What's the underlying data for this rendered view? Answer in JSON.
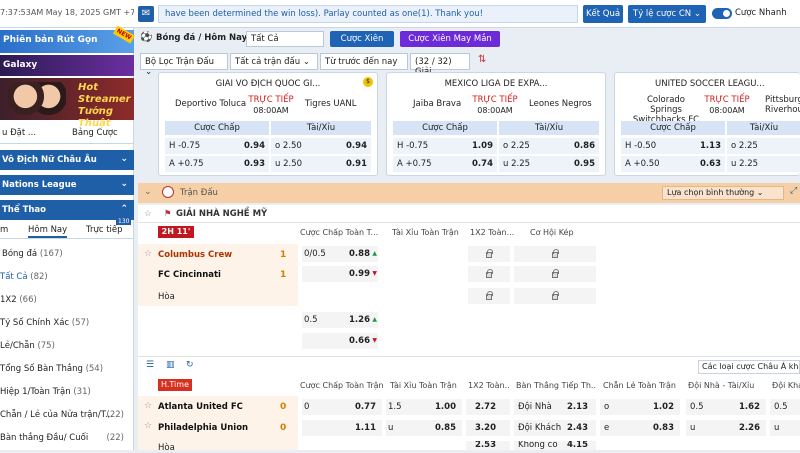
{
  "topbar": {
    "time": "7:37:53AM May 18, 2025 GMT +7",
    "marquee": "have been determined the win loss). Parlay counted as one(1). Thank you!",
    "ket_qua": "Kết Quả",
    "ty_le": "Tỷ lệ cược CN ⌄",
    "toggle_label": "Cược Nhanh"
  },
  "sidebar": {
    "promo1": "Phiên bản Rút Gọn",
    "promo1_badge": "NEW",
    "promo2": "Galaxy",
    "promo3a": "Hot Streamer",
    "promo3b": "Tướng Thuật",
    "tab_left": "u Đặt ...",
    "tab_right": "Bảng Cược",
    "sec1": "Vô Địch Nữ Châu Âu",
    "sec2": "Nations League",
    "sec3": "Thể Thao",
    "subtabs": [
      "m",
      "Hôm Nay",
      "Trực tiếp"
    ],
    "live_badge": "130",
    "items": [
      {
        "label": "Bóng đá",
        "count": "(167)"
      },
      {
        "label": "Tất Cả",
        "count": "(82)"
      },
      {
        "label": "1X2",
        "count": "(66)"
      },
      {
        "label": "Tỷ Số Chính Xác",
        "count": "(57)"
      },
      {
        "label": "Lẻ/Chẵn",
        "count": "(75)"
      },
      {
        "label": "Tổng Số Bàn Thắng",
        "count": "(54)"
      },
      {
        "label": "Hiệp 1/Toàn Trận",
        "count": "(31)"
      },
      {
        "label": "Chẵn / Lẻ của Nửa trận/T...",
        "count": "(22)"
      },
      {
        "label": "Bàn thắng Đầu/ Cuối",
        "count": "(22)"
      }
    ]
  },
  "header": {
    "sport": "Bóng đá / Hôm Nay",
    "filter_all": "Tất Cả",
    "xien": "Cược Xiên",
    "xien_mm": "Cược Xiên May Mắn",
    "filters": [
      "Bộ Lọc Trận Đấu ⌄",
      "Tất cả trận đấu ⌄",
      "Từ trước đến nay ⌄",
      "(32 / 32) Giải"
    ]
  },
  "cards": [
    {
      "league": "GIẢI VÔ ĐỊCH QUỐC GI...",
      "home": "Deportivo Toluca",
      "away": "Tigres UANL",
      "live": "TRỰC TIẾP",
      "time": "08:00AM",
      "h1": "Cược Chấp",
      "h2": "Tài/Xỉu",
      "r1": [
        "H",
        "-0.75",
        "0.94",
        "o",
        "2.50",
        "0.94"
      ],
      "r2": [
        "A",
        "+0.75",
        "0.93",
        "u",
        "2.50",
        "0.91"
      ]
    },
    {
      "league": "MEXICO LIGA DE EXPA...",
      "home": "Jaiba Brava",
      "away": "Leones Negros",
      "live": "TRỰC TIẾP",
      "time": "08:00AM",
      "h1": "Cược Chấp",
      "h2": "Tài/Xỉu",
      "r1": [
        "H",
        "-0.75",
        "1.09",
        "o",
        "2.25",
        "0.86"
      ],
      "r2": [
        "A",
        "+0.75",
        "0.74",
        "u",
        "2.25",
        "0.95"
      ]
    },
    {
      "league": "UNITED SOCCER LEAGU...",
      "home": "Colorado Springs Switchbacks FC",
      "away": "Pittsburg Riverhour",
      "live": "TRỰC TIẾP",
      "time": "08:00AM",
      "h1": "Cược Chấp",
      "h2": "Tài/Xỉu",
      "r1": [
        "H",
        "-0.50",
        "1.13",
        "o",
        "2.25",
        ""
      ],
      "r2": [
        "A",
        "+0.50",
        "0.63",
        "u",
        "2.25",
        ""
      ]
    }
  ],
  "main": {
    "section_title": "Trận Đấu",
    "sort": "Lựa chọn bình thường ⌄",
    "league": "GIẢI NHÀ NGHỀ MỸ",
    "cols1": [
      "Cược Chấp Toàn T...",
      "Tài Xỉu Toàn Trận",
      "1X2 Toàn...",
      "Cơ Hội Kép"
    ],
    "m1": {
      "status": "2H 11'",
      "home": "Columbus Crew",
      "away": "FC Cincinnati",
      "draw": "Hòa",
      "hs": "1",
      "as": "1",
      "hcap": "0/0.5",
      "o1": "0.88",
      "o2": "0.99",
      "hcap2": "0.5",
      "o3": "1.26",
      "o4": "0.66"
    },
    "other_sort": "Các loại cược Châu Á khác ⌄",
    "cols2": [
      "Cược Chấp Toàn Trận",
      "Tài Xỉu Toàn Trận",
      "1X2 Toàn...",
      "Bàn Thắng Tiếp Th...",
      "Chẵn Lẻ Toàn Trận",
      "Đội Nhà - Tài/Xỉu",
      "Đội Khá"
    ],
    "m2": {
      "status": "H.Time",
      "home": "Atlanta United FC",
      "away": "Philadelphia Union",
      "draw": "Hòa",
      "hs": "0",
      "as": "0",
      "r1": [
        "0",
        "0.77",
        "1.5",
        "1.00",
        "2.72",
        "Đội Nhà",
        "2.13",
        "o",
        "1.02",
        "0.5",
        "1.62",
        "0.5"
      ],
      "r2": [
        "",
        "1.11",
        "u",
        "0.85",
        "3.20",
        "Đội Khách",
        "2.43",
        "e",
        "0.83",
        "u",
        "2.26",
        "u"
      ],
      "r3": [
        "2.53",
        "Không có",
        "4.15"
      ]
    }
  }
}
